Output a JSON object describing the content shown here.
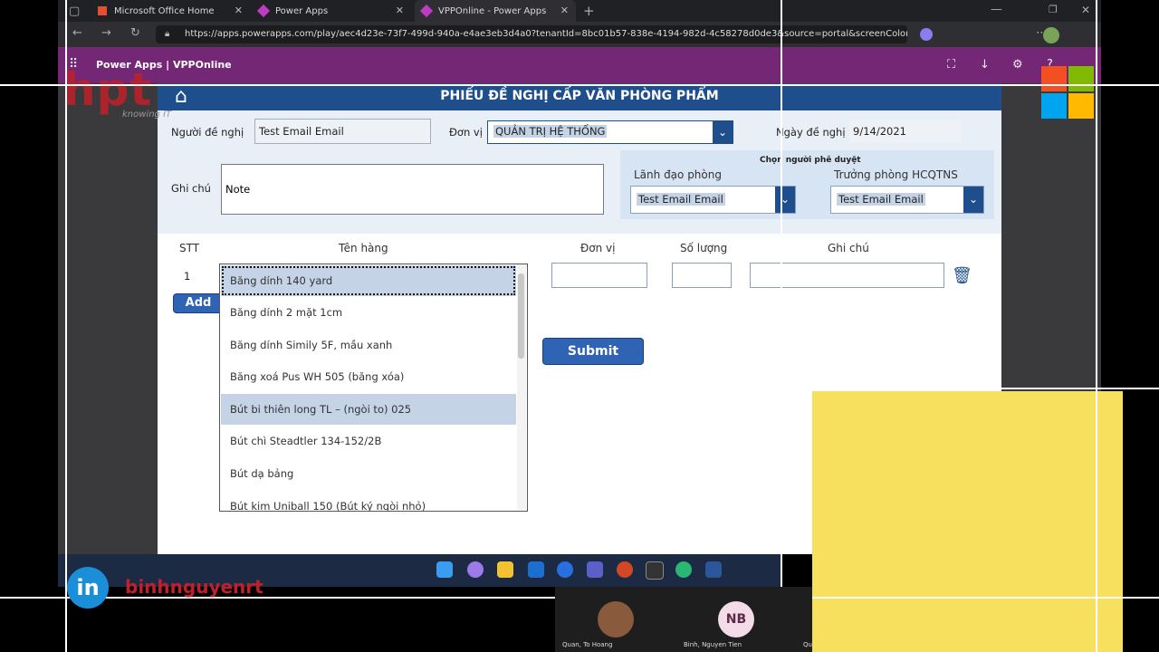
{
  "browser": {
    "tabs": [
      {
        "label": "Microsoft Office Home"
      },
      {
        "label": "Power Apps"
      },
      {
        "label": "VPPOnline - Power Apps"
      }
    ],
    "url": "https://apps.powerapps.com/play/aec4d23e-73f7-499d-940a-e4ae3eb3d4a0?tenantId=8bc01b57-838e-4194-982d-4c58278d0de3&source=portal&screenColor=r..."
  },
  "header": {
    "title": "Power Apps  |  VPPOnline"
  },
  "form": {
    "title": "PHIẾU ĐỀ NGHỊ CẤP VĂN PHÒNG PHẨM",
    "requester_label": "Người đề nghị",
    "requester_value": "Test Email Email",
    "unit_label": "Đơn vị",
    "unit_value": "QUẢN TRỊ HỆ THỐNG",
    "date_label": "Ngày đề nghị",
    "date_value": "9/14/2021",
    "note_label": "Ghi chú",
    "note_value": "Note",
    "approver_title": "Chọn người phê duyệt",
    "manager_label": "Lãnh đạo phòng",
    "manager_value": "Test Email Email",
    "head_label": "Trưởng phòng HCQTNS",
    "head_value": "Test Email Email"
  },
  "table": {
    "headers": {
      "stt": "STT",
      "item": "Tên hàng",
      "unit": "Đơn vị",
      "qty": "Số lượng",
      "note": "Ghi chú"
    },
    "row_number": "1",
    "add_label": "Add",
    "submit_label": "Submit"
  },
  "list_options": [
    "Băng dính 140 yard",
    "Băng dính 2 mặt 1cm",
    "Băng dính Simily 5F, mầu xanh",
    "Băng xoá Pus WH 505 (băng xóa)",
    "Bút bi thiên long TL – (ngòi to) 025",
    "Bút chì Steadtler 134-152/2B",
    "Bút dạ bảng",
    "Bút kim Uniball 150 (Bút ký ngòi nhỏ)"
  ],
  "overlay": {
    "brand": "hpt",
    "tagline": "knowing IT",
    "linkedin_name": "binhnguyenrt",
    "participant1": "Quan, To Hoang",
    "participant2": "Binh, Nguyen Tien",
    "participant2_initials": "NB",
    "participant3": "Qu"
  },
  "colors": {
    "brand_purple": "#742774",
    "app_blue": "#1f4e8c",
    "accent_yellow": "#f6e05e"
  }
}
